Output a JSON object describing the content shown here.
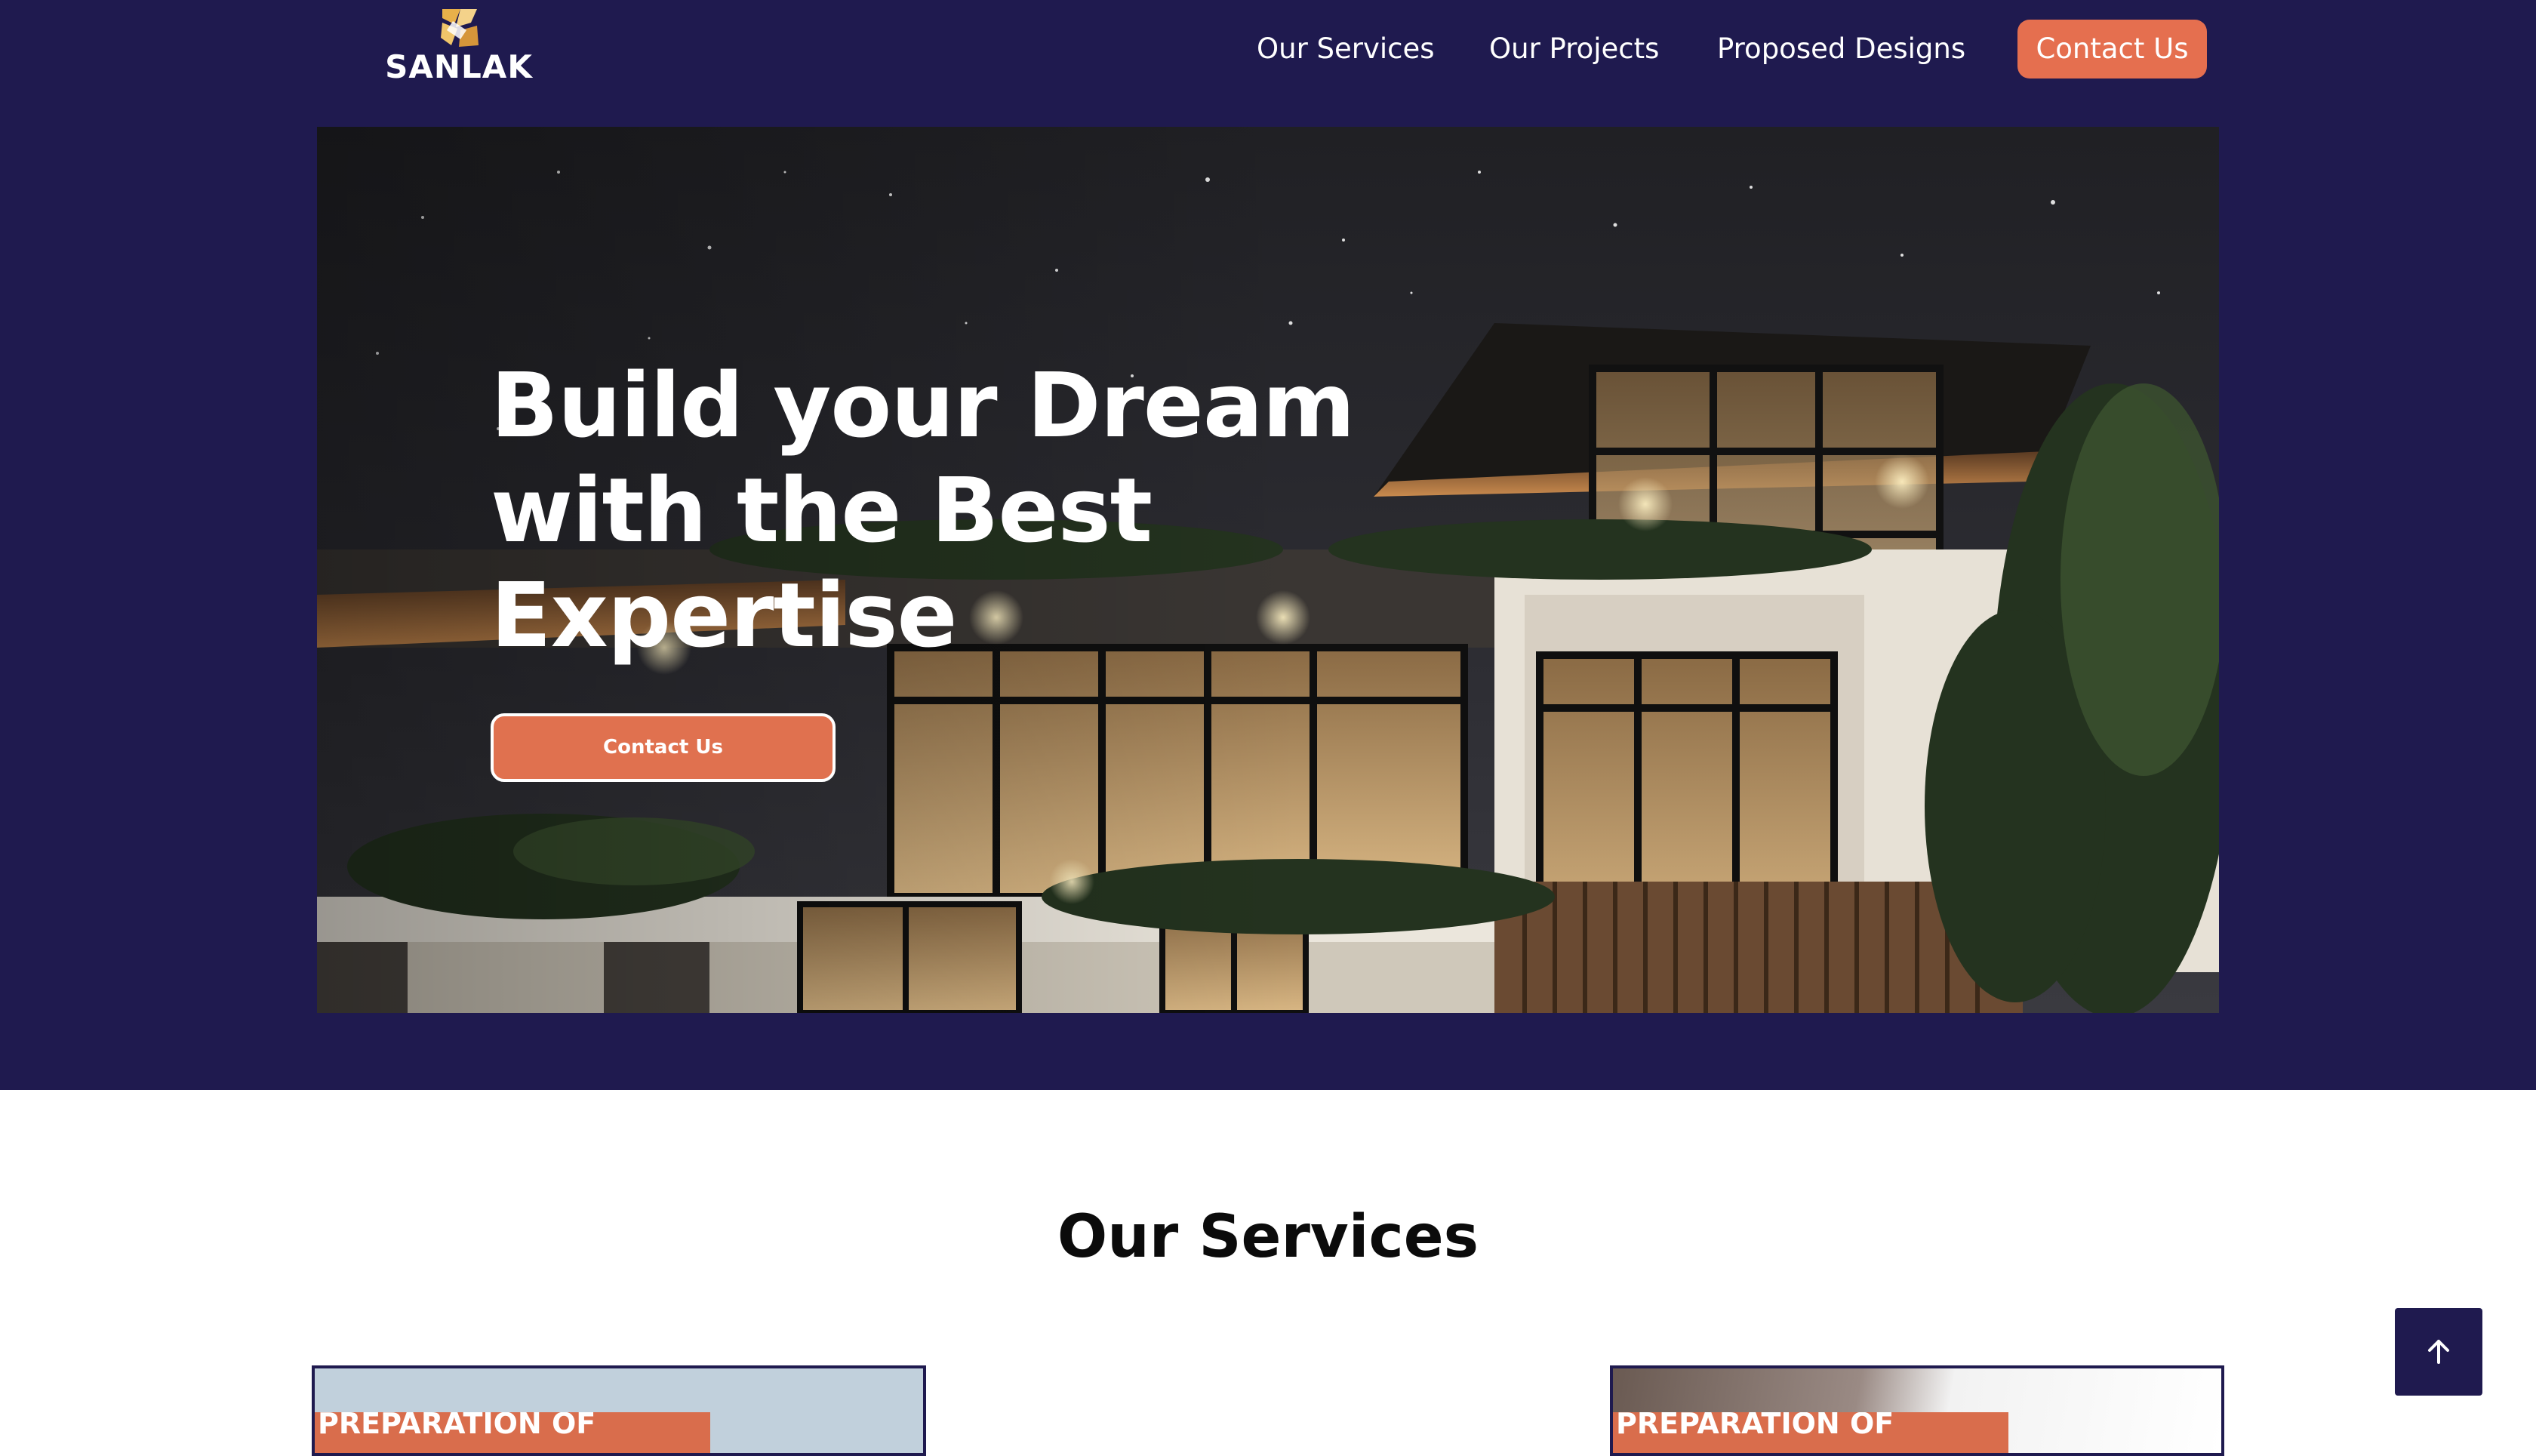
{
  "brand": {
    "name": "SANLAK",
    "icon": "sanlak-logo-mark"
  },
  "nav": {
    "items": [
      {
        "label": "Our Services"
      },
      {
        "label": "Our Projects"
      },
      {
        "label": "Proposed Designs"
      }
    ],
    "contact_label": "Contact Us"
  },
  "hero": {
    "title_lines": [
      "Build your Dream",
      "with the Best",
      "Expertise"
    ],
    "button_label": "Contact Us",
    "image": "modern-house-night-photo"
  },
  "services": {
    "title": "Our Services",
    "cards": [
      {
        "tag": "PREPARATION OF"
      },
      {
        "tag": "PREPARATION OF"
      }
    ]
  },
  "back_to_top": {
    "icon": "arrow-up-icon"
  },
  "colors": {
    "navy": "#1f1a4f",
    "accent": "#e56f4f",
    "white": "#ffffff",
    "title_dark": "#0b0b0b"
  }
}
